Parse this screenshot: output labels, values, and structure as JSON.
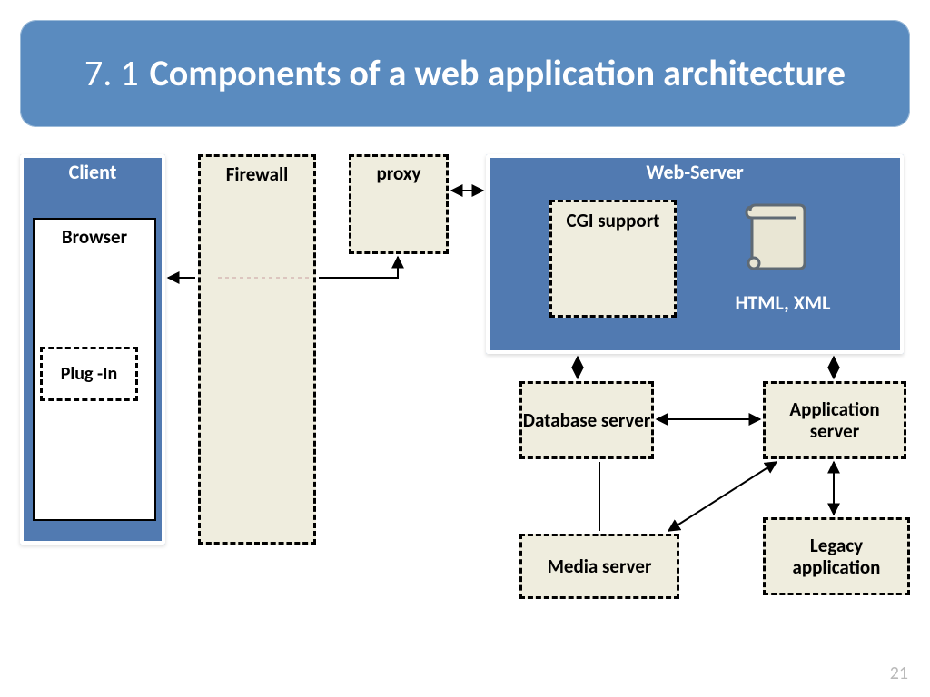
{
  "title": {
    "number": "7. 1",
    "text": "Components of a web application architecture"
  },
  "client": {
    "label": "Client",
    "browser": "Browser",
    "plugin": "Plug -In"
  },
  "firewall": "Firewall",
  "proxy": "proxy",
  "webserver": {
    "label": "Web-Server",
    "cgi": "CGI support",
    "htmlxml": "HTML, XML"
  },
  "database": "Database server",
  "appserver": "Application server",
  "media": "Media server",
  "legacy": "Legacy application",
  "page_number": "21"
}
